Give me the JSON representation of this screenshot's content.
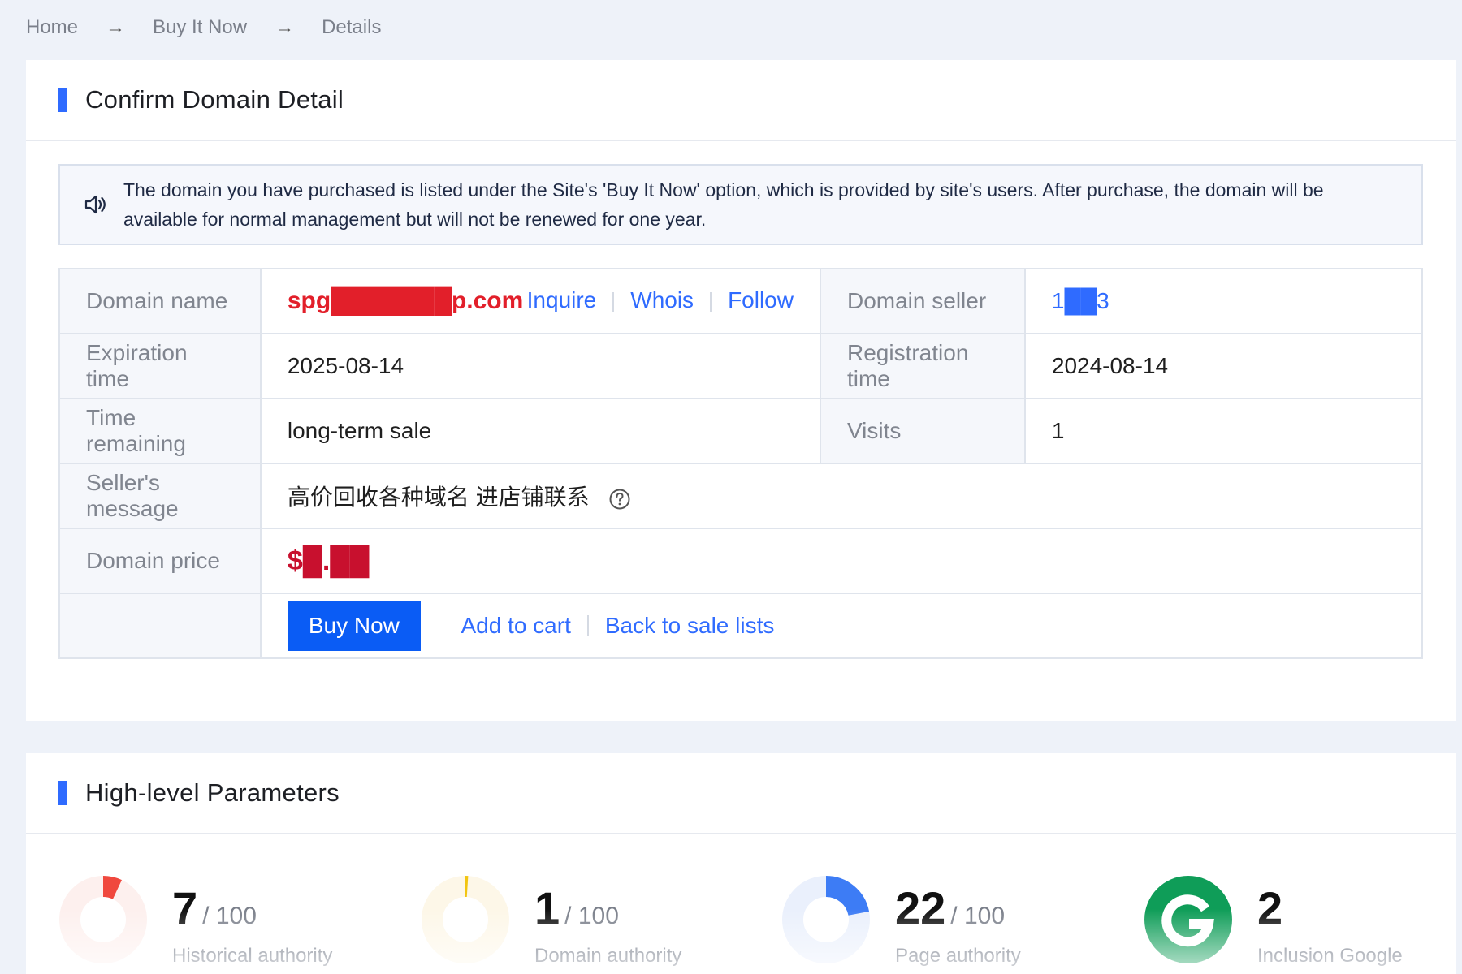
{
  "breadcrumb": {
    "items": [
      "Home",
      "Buy It Now",
      "Details"
    ],
    "separator": "→"
  },
  "detail": {
    "title": "Confirm Domain Detail",
    "notice": "The domain you have purchased is listed under the Site's 'Buy It Now' option, which is provided by site's users. After purchase, the domain will be available for normal management but will not be renewed for one year.",
    "rows": {
      "domain_name_label": "Domain name",
      "domain_name_value": "spg███████p.com",
      "inquire": "Inquire",
      "whois": "Whois",
      "follow": "Follow",
      "seller_label": "Domain seller",
      "seller_value": "1██3",
      "expiration_label": "Expiration time",
      "expiration_value": "2025-08-14",
      "registration_label": "Registration time",
      "registration_value": "2024-08-14",
      "remaining_label": "Time remaining",
      "remaining_value": "long-term sale",
      "visits_label": "Visits",
      "visits_value": "1",
      "message_label": "Seller's message",
      "message_value": "高价回收各种域名 进店铺联系",
      "price_label": "Domain price",
      "price_value": "$█.██"
    },
    "actions": {
      "buy_now": "Buy Now",
      "add_to_cart": "Add to cart",
      "back": "Back to sale lists"
    }
  },
  "params": {
    "title": "High-level Parameters",
    "metrics": [
      {
        "value": "7",
        "denominator": "/ 100",
        "label": "Historical authority",
        "fraction": 0.07,
        "color": "#f0483e",
        "track": "#fdf0ee"
      },
      {
        "value": "1",
        "denominator": "/ 100",
        "label": "Domain authority",
        "fraction": 0.01,
        "color": "#f2c511",
        "track": "#fdf7e8"
      },
      {
        "value": "22",
        "denominator": "/ 100",
        "label": "Page authority",
        "fraction": 0.22,
        "color": "#3d7cf5",
        "track": "#eaf0fc"
      },
      {
        "value": "2",
        "denominator": "",
        "label": "Inclusion Google",
        "icon": "google-icon",
        "color": "#0f9d58"
      }
    ]
  },
  "colors": {
    "accent": "#2f6bff",
    "price": "#c8102e",
    "domain": "#e21f2a"
  }
}
